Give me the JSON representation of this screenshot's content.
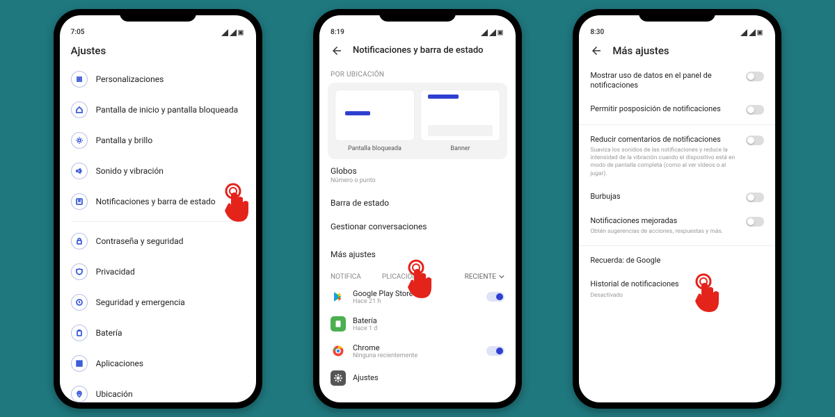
{
  "phones": [
    {
      "time": "7:05",
      "title": "Ajustes",
      "items": [
        {
          "icon": "paint",
          "label": "Personalizaciones"
        },
        {
          "icon": "home",
          "label": "Pantalla de inicio y pantalla bloqueada"
        },
        {
          "icon": "bright",
          "label": "Pantalla y brillo"
        },
        {
          "icon": "sound",
          "label": "Sonido y vibración"
        },
        {
          "icon": "notif",
          "label": "Notificaciones y barra de estado"
        },
        {
          "icon": "lock",
          "label": "Contraseña y seguridad"
        },
        {
          "icon": "privacy",
          "label": "Privacidad"
        },
        {
          "icon": "emerg",
          "label": "Seguridad y emergencia"
        },
        {
          "icon": "battery",
          "label": "Batería"
        },
        {
          "icon": "apps",
          "label": "Aplicaciones"
        },
        {
          "icon": "location",
          "label": "Ubicación"
        }
      ]
    },
    {
      "time": "8:19",
      "title": "Notificaciones y barra de estado",
      "section_location": "POR UBICACIÓN",
      "cards": [
        {
          "label": "Pantalla bloqueada"
        },
        {
          "label": "Banner"
        }
      ],
      "globos": {
        "title": "Globos",
        "sub": "Número o punto"
      },
      "barra": "Barra de estado",
      "gestionar": "Gestionar conversaciones",
      "mas": "Más ajustes",
      "section_apps_left": "NOTIFICA",
      "section_apps_right": "PLICACIONES",
      "reciente": "RECIENTE",
      "apps": [
        {
          "name": "Google Play Store",
          "sub": "Hace 21 h",
          "toggle": true,
          "color": "#fff",
          "icon": "play"
        },
        {
          "name": "Batería",
          "sub": "Hace 1 d",
          "toggle": false,
          "color": "#4caf50",
          "icon": "bat"
        },
        {
          "name": "Chrome",
          "sub": "Ninguna recientemente",
          "toggle": true,
          "color": "#fff",
          "icon": "chrome"
        },
        {
          "name": "Ajustes",
          "sub": "",
          "toggle": false,
          "color": "#555",
          "icon": "gear"
        }
      ]
    },
    {
      "time": "8:30",
      "title": "Más ajustes",
      "rows": [
        {
          "title": "Mostrar uso de datos en el panel de notificaciones",
          "sub": "",
          "sw": true
        },
        {
          "title": "Permitir posposición de notificaciones",
          "sub": "",
          "sw": true
        },
        {
          "title": "Reducir comentarios de notificaciones",
          "sub": "Suaviza los sonidos de las notificaciones y reduce la intensidad de la vibración cuando el dispositivo está en modo de pantalla completa (como al ver vídeos o al jugar).",
          "sw": true
        },
        {
          "title": "Burbujas",
          "sub": "",
          "sw": true
        },
        {
          "title": "Notificaciones mejoradas",
          "sub": "Obtén sugerencias de acciones, respuestas y más.",
          "sw": true
        },
        {
          "title": "Recuerda: de Google",
          "sub": "",
          "sw": false
        },
        {
          "title": "Historial de notificaciones",
          "sub": "Desactivado",
          "sw": false
        }
      ]
    }
  ]
}
